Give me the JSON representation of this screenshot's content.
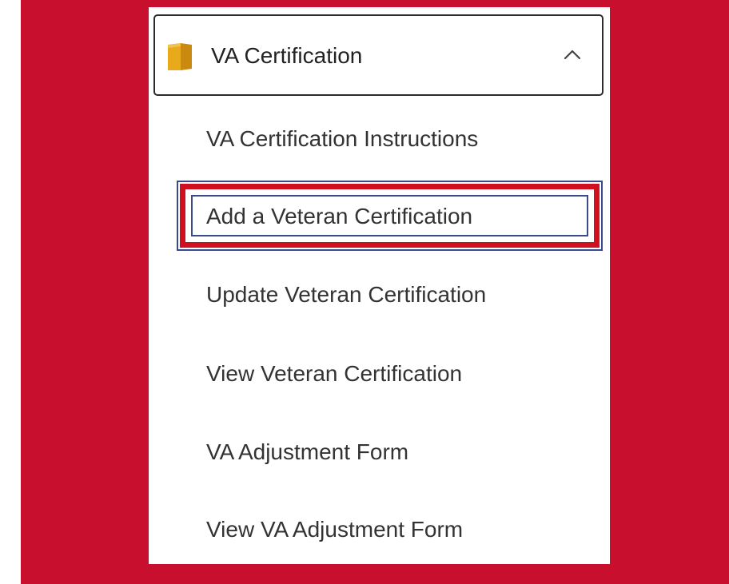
{
  "colors": {
    "background": "#c8102e",
    "panel": "#ffffff",
    "folder_icon": "#e8a91b",
    "highlight": "#d0101f",
    "highlight_border": "#3b4a8c"
  },
  "folder": {
    "label": "VA Certification",
    "icon": "folder-icon",
    "toggle_icon": "chevron-up-icon",
    "expanded": true
  },
  "menu": {
    "items": [
      {
        "label": "VA Certification Instructions"
      },
      {
        "label": "Add a Veteran Certification"
      },
      {
        "label": "Update Veteran Certification"
      },
      {
        "label": "View Veteran Certification"
      },
      {
        "label": "VA Adjustment Form"
      },
      {
        "label": "View VA Adjustment Form"
      }
    ],
    "highlighted_index": 1
  }
}
